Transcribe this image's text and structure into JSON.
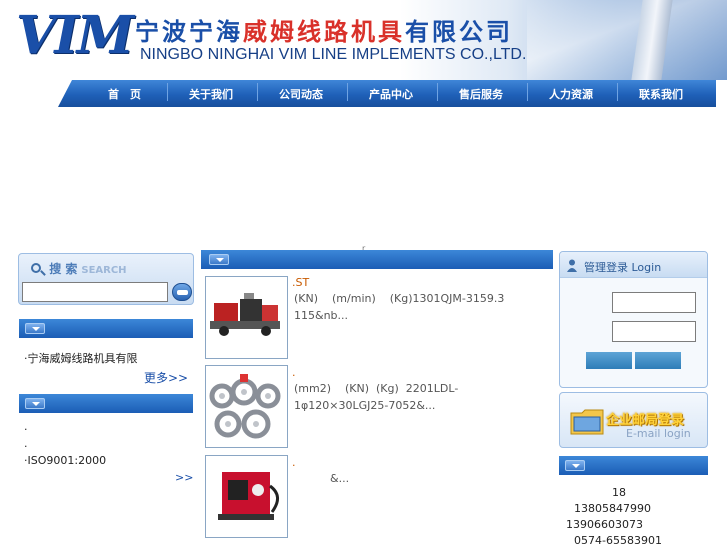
{
  "header": {
    "logo_text": "VIM",
    "company_cn_a": "宁波宁海",
    "company_cn_b": "威姆线路机具",
    "company_cn_c": "有限公司",
    "company_en": "NINGBO NINGHAI VIM LINE IMPLEMENTS CO.,LTD."
  },
  "nav": {
    "items": [
      "首　页",
      "关于我们",
      "公司动态",
      "产品中心",
      "售后服务",
      "人力资源",
      "联系我们"
    ]
  },
  "banner_mark": "r",
  "search": {
    "title": "搜 索",
    "title_en": "SEARCH",
    "input_value": ""
  },
  "left": {
    "news_item": "·宁海威姆线路机具有限",
    "news_more": "更多>>",
    "honor_items": [
      ".",
      ".",
      "·ISO9001:2000"
    ],
    "honor_more": ">>"
  },
  "products": [
    {
      "title": ".ST",
      "desc": "(KN)    (m/min)    (Kg)1301QJM-3159.3\n115&nb..."
    },
    {
      "title": ".",
      "desc": "(mm2)    (KN)  (Kg)  2201LDL-\n1φ120×30LGJ25-7052&..."
    },
    {
      "title": ".",
      "desc": "&..."
    }
  ],
  "login": {
    "title": "管理登录  Login",
    "username_value": "",
    "password_value": ""
  },
  "email": {
    "title_cn": "企业邮局登录",
    "title_en": "E-mail login"
  },
  "contact": {
    "lines": [
      "18",
      "13805847990",
      "13906603073",
      "0574-65583901"
    ]
  },
  "colors": {
    "brand_blue": "#1a4fa8",
    "nav_blue": "#1f60b8",
    "brand_red": "#d9312a",
    "product_title": "#c85a00"
  }
}
